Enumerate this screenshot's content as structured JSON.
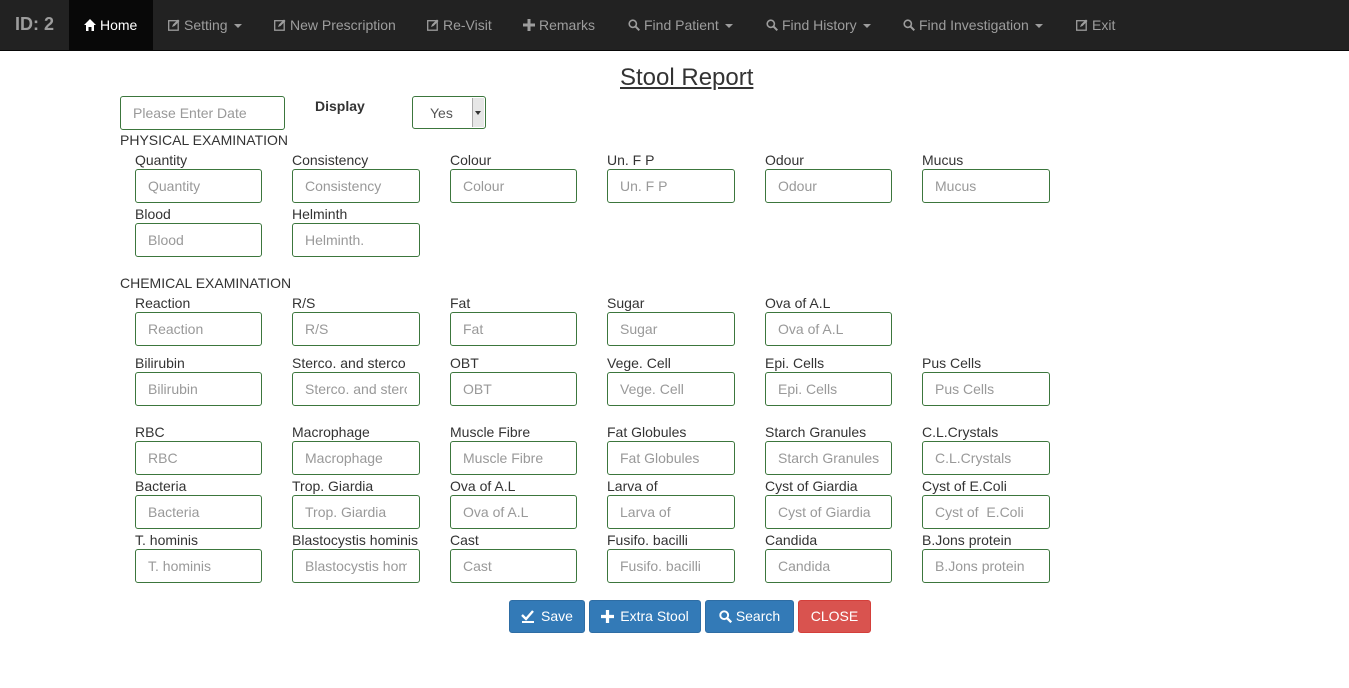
{
  "navbar": {
    "brand": "ID: 2",
    "items": [
      {
        "label": "Home",
        "icon": "home-icon"
      },
      {
        "label": "Setting",
        "icon": "edit-icon"
      },
      {
        "label": "New Prescription",
        "icon": "edit-icon"
      },
      {
        "label": "Re-Visit",
        "icon": "edit-icon"
      },
      {
        "label": "Remarks",
        "icon": "plus-icon"
      },
      {
        "label": "Find Patient",
        "icon": "search-icon"
      },
      {
        "label": "Find History",
        "icon": "search-icon"
      },
      {
        "label": "Find Investigation",
        "icon": "search-icon"
      },
      {
        "label": "Exit",
        "icon": "edit-icon"
      }
    ]
  },
  "page": {
    "title": "Stool Report",
    "date_placeholder": "Please Enter Date",
    "display_label": "Display",
    "display_value": "Yes"
  },
  "physical": {
    "heading": "PHYSICAL EXAMINATION",
    "fields": [
      {
        "label": "Quantity",
        "placeholder": "Quantity"
      },
      {
        "label": "Consistency",
        "placeholder": "Consistency"
      },
      {
        "label": "Colour",
        "placeholder": "Colour"
      },
      {
        "label": "Un. F P",
        "placeholder": "Un. F P"
      },
      {
        "label": "Odour",
        "placeholder": "Odour"
      },
      {
        "label": "Mucus",
        "placeholder": "Mucus"
      },
      {
        "label": "Blood",
        "placeholder": "Blood"
      },
      {
        "label": "Helminth",
        "placeholder": "Helminth."
      }
    ]
  },
  "chemical": {
    "heading": "CHEMICAL EXAMINATION",
    "fields": [
      {
        "label": "Reaction",
        "placeholder": "Reaction"
      },
      {
        "label": "R/S",
        "placeholder": "R/S"
      },
      {
        "label": "Fat",
        "placeholder": "Fat"
      },
      {
        "label": "Sugar",
        "placeholder": "Sugar"
      },
      {
        "label": "Ova of A.L",
        "placeholder": "Ova of A.L"
      },
      {
        "label": "Bilirubin",
        "placeholder": "Bilirubin"
      },
      {
        "label": "Sterco. and sterco",
        "placeholder": "Sterco. and sterco"
      },
      {
        "label": "OBT",
        "placeholder": "OBT"
      },
      {
        "label": "Vege. Cell",
        "placeholder": "Vege. Cell"
      },
      {
        "label": "Epi. Cells",
        "placeholder": "Epi. Cells"
      },
      {
        "label": "Pus Cells",
        "placeholder": "Pus Cells"
      },
      {
        "label": "RBC",
        "placeholder": "RBC"
      },
      {
        "label": "Macrophage",
        "placeholder": "Macrophage"
      },
      {
        "label": "Muscle Fibre",
        "placeholder": "Muscle Fibre"
      },
      {
        "label": "Fat Globules",
        "placeholder": "Fat Globules"
      },
      {
        "label": "Starch Granules",
        "placeholder": "Starch Granules"
      },
      {
        "label": "C.L.Crystals",
        "placeholder": "C.L.Crystals"
      },
      {
        "label": "Bacteria",
        "placeholder": "Bacteria"
      },
      {
        "label": "Trop. Giardia",
        "placeholder": "Trop. Giardia"
      },
      {
        "label": "Ova of A.L",
        "placeholder": "Ova of A.L"
      },
      {
        "label": "Larva of",
        "placeholder": "Larva of"
      },
      {
        "label": "Cyst of Giardia",
        "placeholder": "Cyst of Giardia"
      },
      {
        "label": "Cyst of E.Coli",
        "placeholder": "Cyst of  E.Coli"
      },
      {
        "label": "T. hominis",
        "placeholder": "T. hominis"
      },
      {
        "label": "Blastocystis hominis",
        "placeholder": "Blastocystis hominis"
      },
      {
        "label": "Cast",
        "placeholder": "Cast"
      },
      {
        "label": "Fusifo. bacilli",
        "placeholder": "Fusifo. bacilli"
      },
      {
        "label": "Candida",
        "placeholder": "Candida"
      },
      {
        "label": "B.Jons protein",
        "placeholder": "B.Jons protein"
      }
    ]
  },
  "buttons": {
    "save": "Save",
    "extra": "Extra Stool",
    "search": "Search",
    "close": "CLOSE"
  }
}
